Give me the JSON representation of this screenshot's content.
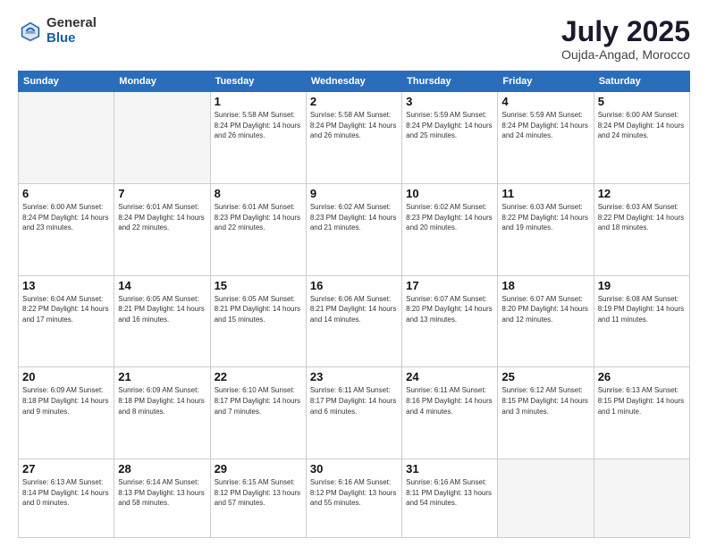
{
  "header": {
    "logo_general": "General",
    "logo_blue": "Blue",
    "month_title": "July 2025",
    "location": "Oujda-Angad, Morocco"
  },
  "weekdays": [
    "Sunday",
    "Monday",
    "Tuesday",
    "Wednesday",
    "Thursday",
    "Friday",
    "Saturday"
  ],
  "weeks": [
    [
      {
        "day": "",
        "info": ""
      },
      {
        "day": "",
        "info": ""
      },
      {
        "day": "1",
        "info": "Sunrise: 5:58 AM\nSunset: 8:24 PM\nDaylight: 14 hours\nand 26 minutes."
      },
      {
        "day": "2",
        "info": "Sunrise: 5:58 AM\nSunset: 8:24 PM\nDaylight: 14 hours\nand 26 minutes."
      },
      {
        "day": "3",
        "info": "Sunrise: 5:59 AM\nSunset: 8:24 PM\nDaylight: 14 hours\nand 25 minutes."
      },
      {
        "day": "4",
        "info": "Sunrise: 5:59 AM\nSunset: 8:24 PM\nDaylight: 14 hours\nand 24 minutes."
      },
      {
        "day": "5",
        "info": "Sunrise: 6:00 AM\nSunset: 8:24 PM\nDaylight: 14 hours\nand 24 minutes."
      }
    ],
    [
      {
        "day": "6",
        "info": "Sunrise: 6:00 AM\nSunset: 8:24 PM\nDaylight: 14 hours\nand 23 minutes."
      },
      {
        "day": "7",
        "info": "Sunrise: 6:01 AM\nSunset: 8:24 PM\nDaylight: 14 hours\nand 22 minutes."
      },
      {
        "day": "8",
        "info": "Sunrise: 6:01 AM\nSunset: 8:23 PM\nDaylight: 14 hours\nand 22 minutes."
      },
      {
        "day": "9",
        "info": "Sunrise: 6:02 AM\nSunset: 8:23 PM\nDaylight: 14 hours\nand 21 minutes."
      },
      {
        "day": "10",
        "info": "Sunrise: 6:02 AM\nSunset: 8:23 PM\nDaylight: 14 hours\nand 20 minutes."
      },
      {
        "day": "11",
        "info": "Sunrise: 6:03 AM\nSunset: 8:22 PM\nDaylight: 14 hours\nand 19 minutes."
      },
      {
        "day": "12",
        "info": "Sunrise: 6:03 AM\nSunset: 8:22 PM\nDaylight: 14 hours\nand 18 minutes."
      }
    ],
    [
      {
        "day": "13",
        "info": "Sunrise: 6:04 AM\nSunset: 8:22 PM\nDaylight: 14 hours\nand 17 minutes."
      },
      {
        "day": "14",
        "info": "Sunrise: 6:05 AM\nSunset: 8:21 PM\nDaylight: 14 hours\nand 16 minutes."
      },
      {
        "day": "15",
        "info": "Sunrise: 6:05 AM\nSunset: 8:21 PM\nDaylight: 14 hours\nand 15 minutes."
      },
      {
        "day": "16",
        "info": "Sunrise: 6:06 AM\nSunset: 8:21 PM\nDaylight: 14 hours\nand 14 minutes."
      },
      {
        "day": "17",
        "info": "Sunrise: 6:07 AM\nSunset: 8:20 PM\nDaylight: 14 hours\nand 13 minutes."
      },
      {
        "day": "18",
        "info": "Sunrise: 6:07 AM\nSunset: 8:20 PM\nDaylight: 14 hours\nand 12 minutes."
      },
      {
        "day": "19",
        "info": "Sunrise: 6:08 AM\nSunset: 8:19 PM\nDaylight: 14 hours\nand 11 minutes."
      }
    ],
    [
      {
        "day": "20",
        "info": "Sunrise: 6:09 AM\nSunset: 8:18 PM\nDaylight: 14 hours\nand 9 minutes."
      },
      {
        "day": "21",
        "info": "Sunrise: 6:09 AM\nSunset: 8:18 PM\nDaylight: 14 hours\nand 8 minutes."
      },
      {
        "day": "22",
        "info": "Sunrise: 6:10 AM\nSunset: 8:17 PM\nDaylight: 14 hours\nand 7 minutes."
      },
      {
        "day": "23",
        "info": "Sunrise: 6:11 AM\nSunset: 8:17 PM\nDaylight: 14 hours\nand 6 minutes."
      },
      {
        "day": "24",
        "info": "Sunrise: 6:11 AM\nSunset: 8:16 PM\nDaylight: 14 hours\nand 4 minutes."
      },
      {
        "day": "25",
        "info": "Sunrise: 6:12 AM\nSunset: 8:15 PM\nDaylight: 14 hours\nand 3 minutes."
      },
      {
        "day": "26",
        "info": "Sunrise: 6:13 AM\nSunset: 8:15 PM\nDaylight: 14 hours\nand 1 minute."
      }
    ],
    [
      {
        "day": "27",
        "info": "Sunrise: 6:13 AM\nSunset: 8:14 PM\nDaylight: 14 hours\nand 0 minutes."
      },
      {
        "day": "28",
        "info": "Sunrise: 6:14 AM\nSunset: 8:13 PM\nDaylight: 13 hours\nand 58 minutes."
      },
      {
        "day": "29",
        "info": "Sunrise: 6:15 AM\nSunset: 8:12 PM\nDaylight: 13 hours\nand 57 minutes."
      },
      {
        "day": "30",
        "info": "Sunrise: 6:16 AM\nSunset: 8:12 PM\nDaylight: 13 hours\nand 55 minutes."
      },
      {
        "day": "31",
        "info": "Sunrise: 6:16 AM\nSunset: 8:11 PM\nDaylight: 13 hours\nand 54 minutes."
      },
      {
        "day": "",
        "info": ""
      },
      {
        "day": "",
        "info": ""
      }
    ]
  ]
}
